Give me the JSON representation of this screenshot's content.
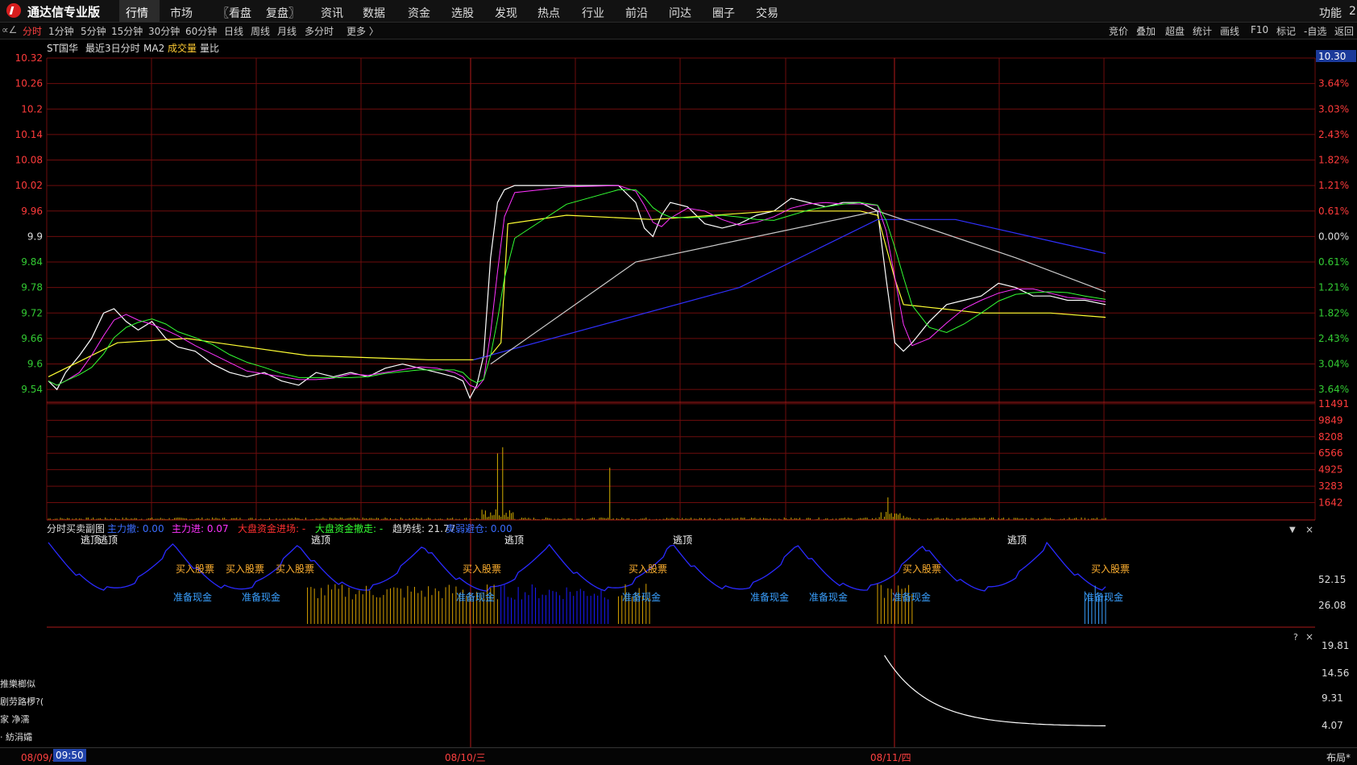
{
  "app": {
    "title": "通达信专业版"
  },
  "menu": [
    "行情",
    "市场",
    "〖看盘",
    "复盘〗",
    "资讯",
    "数据",
    "资金",
    "选股",
    "发现",
    "热点",
    "行业",
    "前沿",
    "问达",
    "圈子",
    "交易"
  ],
  "menu_right": {
    "func": "功能",
    "extra": "2"
  },
  "toolbar": {
    "corner": "∝∠",
    "periods": [
      "分时",
      "1分钟",
      "5分钟",
      "15分钟",
      "30分钟",
      "60分钟",
      "日线",
      "周线",
      "月线",
      "多分时",
      "更多 〉"
    ],
    "right": [
      "竞价",
      "叠加",
      "超盘",
      "统计",
      "画线",
      "F10",
      "标记",
      "-自选",
      "返回"
    ]
  },
  "chart_header": {
    "stock": "ST国华",
    "mode": "最近3日分时",
    "ma": "MA2",
    "vol": "成交量",
    "ratio": "量比"
  },
  "sub_header": {
    "name": "分时买卖副图",
    "items": [
      {
        "label": "主力撤: 0.00",
        "color": "#3a6dff"
      },
      {
        "label": "主力进: 0.07",
        "color": "#ff33ff"
      },
      {
        "label": "大盘资金进场: -",
        "color": "#ff3030"
      },
      {
        "label": "大盘资金撤走: -",
        "color": "#33ff33"
      },
      {
        "label": "趋势线: 21.77",
        "color": "#dddddd"
      },
      {
        "label": "卖弱避仓: 0.00",
        "color": "#3a6dff"
      }
    ]
  },
  "signals": {
    "top": "逃顶",
    "buy": "买入股票",
    "cash": "准备现金"
  },
  "left_panel": [
    "推樂榔似",
    "剧劳路椤?(",
    "家  净濡",
    "·  紡涓孀"
  ],
  "status_badge": "10.30",
  "time_badge": "09:50",
  "bottom": {
    "layout": "布局*"
  },
  "colors": {
    "up": "#ff3b3b",
    "down": "#33cc33",
    "grid": "#7a1010",
    "price": "#ffffff",
    "avg": "#ffff33",
    "accent_blue": "#3a3aff"
  },
  "chart_data": {
    "type": "line",
    "title": "ST国华 最近3日分时",
    "x_labels": [
      "08/09/二",
      "08/10/三",
      "08/11/四"
    ],
    "price_axis": {
      "ticks": [
        10.32,
        10.26,
        10.2,
        10.14,
        10.08,
        10.02,
        9.96,
        9.9,
        9.84,
        9.78,
        9.72,
        9.66,
        9.6,
        9.54
      ],
      "ylim": [
        9.51,
        10.32
      ],
      "prev_close": 9.9,
      "pct_ticks": [
        "3.64%",
        "3.03%",
        "2.43%",
        "1.82%",
        "1.21%",
        "0.61%",
        "0.00%",
        "0.61%",
        "1.21%",
        "1.82%",
        "2.43%",
        "3.04%",
        "3.64%"
      ]
    },
    "volume_axis": {
      "ticks": [
        11491,
        9849,
        8208,
        6566,
        4925,
        3283,
        1642
      ]
    },
    "sub_axis": {
      "ticks": [
        "52.15",
        "26.08"
      ]
    },
    "ratio_axis": {
      "ticks": [
        "19.81",
        "14.56",
        "9.31",
        "4.07"
      ]
    },
    "series": [
      {
        "name": "price",
        "points": [
          [
            0,
            9.56
          ],
          [
            5,
            9.54
          ],
          [
            10,
            9.58
          ],
          [
            18,
            9.62
          ],
          [
            25,
            9.66
          ],
          [
            32,
            9.72
          ],
          [
            38,
            9.73
          ],
          [
            45,
            9.7
          ],
          [
            52,
            9.68
          ],
          [
            60,
            9.7
          ],
          [
            68,
            9.66
          ],
          [
            75,
            9.64
          ],
          [
            85,
            9.63
          ],
          [
            95,
            9.6
          ],
          [
            105,
            9.58
          ],
          [
            115,
            9.57
          ],
          [
            125,
            9.58
          ],
          [
            135,
            9.56
          ],
          [
            145,
            9.55
          ],
          [
            155,
            9.58
          ],
          [
            165,
            9.57
          ],
          [
            175,
            9.58
          ],
          [
            185,
            9.57
          ],
          [
            195,
            9.59
          ],
          [
            205,
            9.6
          ],
          [
            215,
            9.59
          ],
          [
            225,
            9.58
          ],
          [
            235,
            9.57
          ],
          [
            240,
            9.56
          ],
          [
            244,
            9.52
          ],
          [
            248,
            9.55
          ],
          [
            252,
            9.62
          ],
          [
            256,
            9.85
          ],
          [
            260,
            9.98
          ],
          [
            264,
            10.01
          ],
          [
            270,
            10.02
          ],
          [
            300,
            10.02
          ],
          [
            330,
            10.02
          ],
          [
            340,
            9.98
          ],
          [
            345,
            9.92
          ],
          [
            350,
            9.9
          ],
          [
            355,
            9.95
          ],
          [
            360,
            9.98
          ],
          [
            370,
            9.97
          ],
          [
            380,
            9.93
          ],
          [
            390,
            9.92
          ],
          [
            400,
            9.93
          ],
          [
            410,
            9.95
          ],
          [
            420,
            9.96
          ],
          [
            430,
            9.99
          ],
          [
            440,
            9.98
          ],
          [
            450,
            9.97
          ],
          [
            460,
            9.98
          ],
          [
            470,
            9.98
          ],
          [
            480,
            9.96
          ],
          [
            485,
            9.8
          ],
          [
            490,
            9.65
          ],
          [
            495,
            9.63
          ],
          [
            500,
            9.65
          ],
          [
            510,
            9.7
          ],
          [
            520,
            9.74
          ],
          [
            530,
            9.75
          ],
          [
            540,
            9.76
          ],
          [
            550,
            9.79
          ],
          [
            560,
            9.78
          ],
          [
            570,
            9.76
          ],
          [
            580,
            9.76
          ],
          [
            590,
            9.75
          ],
          [
            600,
            9.75
          ],
          [
            612,
            9.74
          ]
        ]
      },
      {
        "name": "avg",
        "points": [
          [
            0,
            9.57
          ],
          [
            40,
            9.65
          ],
          [
            80,
            9.66
          ],
          [
            150,
            9.62
          ],
          [
            220,
            9.61
          ],
          [
            246,
            9.61
          ],
          [
            256,
            9.62
          ],
          [
            262,
            9.65
          ],
          [
            266,
            9.93
          ],
          [
            300,
            9.95
          ],
          [
            350,
            9.94
          ],
          [
            420,
            9.96
          ],
          [
            470,
            9.96
          ],
          [
            480,
            9.95
          ],
          [
            490,
            9.8
          ],
          [
            495,
            9.74
          ],
          [
            540,
            9.72
          ],
          [
            580,
            9.72
          ],
          [
            612,
            9.71
          ]
        ]
      },
      {
        "name": "ma_blue",
        "points": [
          [
            246,
            9.61
          ],
          [
            400,
            9.78
          ],
          [
            480,
            9.94
          ],
          [
            525,
            9.94
          ],
          [
            612,
            9.86
          ]
        ]
      },
      {
        "name": "ma_white",
        "points": [
          [
            256,
            9.6
          ],
          [
            340,
            9.84
          ],
          [
            480,
            9.96
          ],
          [
            560,
            9.85
          ],
          [
            612,
            9.77
          ]
        ]
      }
    ],
    "volume_spikes": [
      [
        260,
        6500
      ],
      [
        263,
        7100
      ],
      [
        325,
        5100
      ],
      [
        486,
        2200
      ]
    ]
  }
}
